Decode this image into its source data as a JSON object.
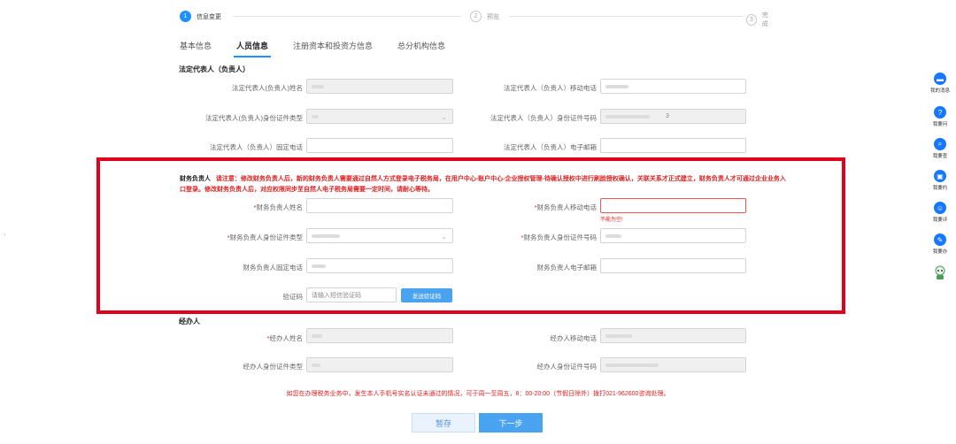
{
  "steps": [
    {
      "num": "1",
      "label": "信息变更"
    },
    {
      "num": "2",
      "label": "预览"
    },
    {
      "num": "3",
      "label": "完成"
    }
  ],
  "tabs": [
    "基本信息",
    "人员信息",
    "注册资本和投资方信息",
    "总分机构信息"
  ],
  "legal": {
    "title": "法定代表人（负责人）",
    "name_label": "法定代表人(负责人)姓名",
    "mobile_label": "法定代表人（负责人）移动电话",
    "idtype_label": "法定代表人(负责人)身份证件类型",
    "idno_label": "法定代表人（负责人）身份证件号码",
    "idno_tail": "3",
    "phone_label": "法定代表人（负责人）固定电话",
    "email_label": "法定代表人（负责人）电子邮箱"
  },
  "finance": {
    "who": "财务负责人",
    "notice": "请注意：修改财务负责人后，新的财务负责人需要通过自然人方式登录电子税务局，在用户中心-账户中心-企业授权管理-待确认授权中进行刷脸授权确认，关联关系才正式建立，财务负责人才可通过企业业务入口登录。修改财务负责人后，对应权限同步至自然人电子税务局需要一定时间，请耐心等待。",
    "name_label": "财务负责人姓名",
    "mobile_label": "财务负责人移动电话",
    "mobile_error": "不能为空!",
    "idtype_label": "财务负责人身份证件类型",
    "idno_label": "财务负责人身份证件号码",
    "phone_label": "财务负责人固定电话",
    "email_label": "财务负责人电子邮箱",
    "code_label": "验证码",
    "code_placeholder": "请输入短信验证码",
    "send_code": "发送验证码"
  },
  "handler": {
    "title": "经办人",
    "name_label": "经办人姓名",
    "mobile_label": "经办人移动电话",
    "idtype_label": "经办人身份证件类型",
    "idno_label": "经办人身份证件号码"
  },
  "footer_note": "如您在办理税务业务中，发生本人手机号实名认证未通过的情况，可于周一至周五，8：00-20:00（节假日除外）拨打021-962600咨询处理。",
  "buttons": {
    "save": "暂存",
    "next": "下一步"
  },
  "sidebar": [
    {
      "label": "我的消息",
      "icon": "message-icon"
    },
    {
      "label": "我要问",
      "icon": "question-icon"
    },
    {
      "label": "我要查",
      "icon": "search-icon"
    },
    {
      "label": "我要约",
      "icon": "appointment-icon"
    },
    {
      "label": "我要评",
      "icon": "rate-icon"
    },
    {
      "label": "我要办",
      "icon": "edit-icon"
    }
  ],
  "colors": {
    "accent": "#1e90ff",
    "error": "#e02020",
    "highlight_box": "#e0001b"
  }
}
